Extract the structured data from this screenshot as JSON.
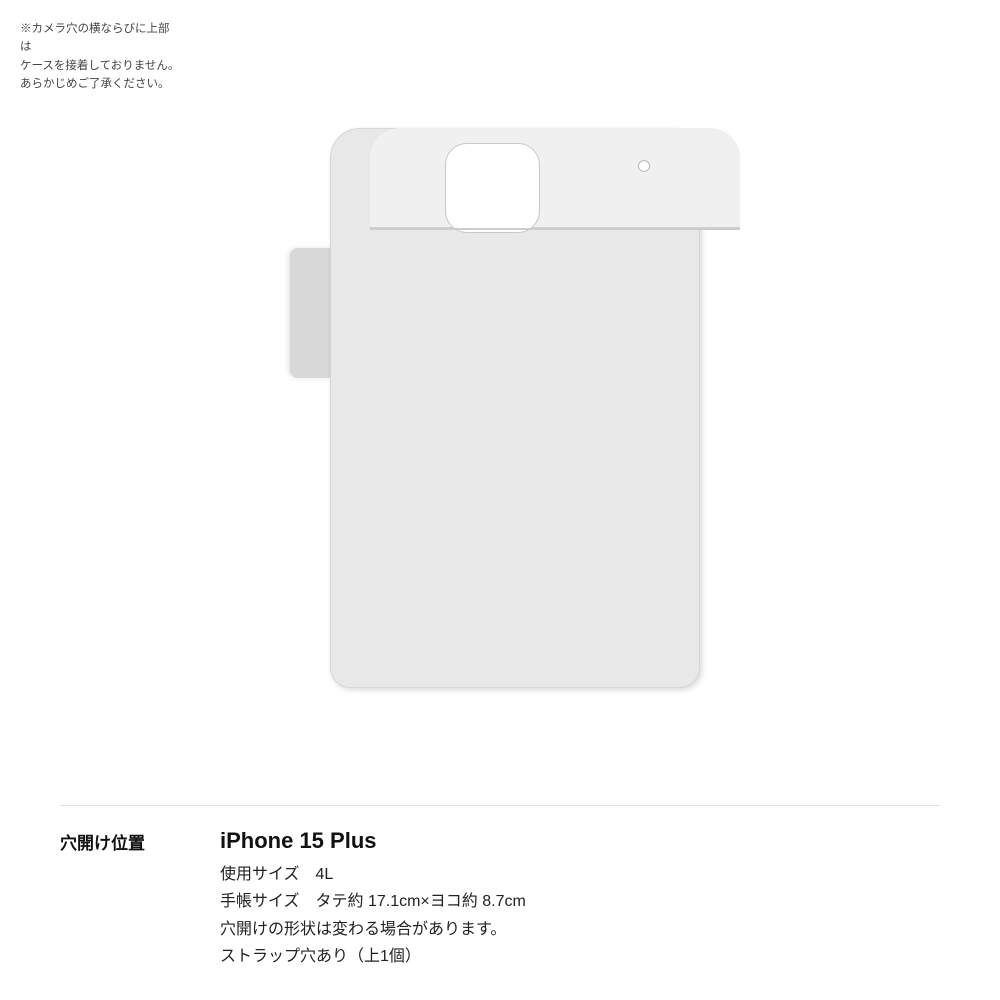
{
  "note": {
    "line1": "※カメラ穴の横ならびに上部は",
    "line2": "ケースを接着しておりません。",
    "line3": "あらかじめご了承ください。"
  },
  "case_image": {
    "alt": "iPhone 15 Plus手帳型ケース背面図"
  },
  "info_section": {
    "label": "穴開け位置",
    "device_name": "iPhone 15 Plus",
    "rows": [
      "使用サイズ　4L",
      "手帳サイズ　タテ約 17.1cm×ヨコ約 8.7cm",
      "穴開けの形状は変わる場合があります。",
      "ストラップ穴あり（上1個）"
    ]
  }
}
